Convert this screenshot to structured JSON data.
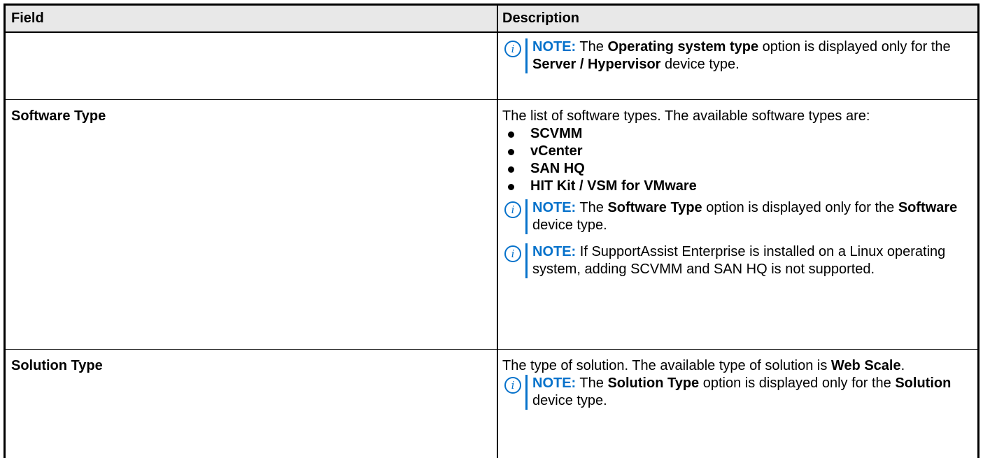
{
  "header": {
    "field": "Field",
    "description": "Description"
  },
  "row1": {
    "note_label": "NOTE:",
    "note_t1": " The ",
    "note_b1": "Operating system type",
    "note_t2": " option is displayed only for the ",
    "note_b2": "Server / Hypervisor",
    "note_t3": " device type."
  },
  "row2": {
    "field": "Software Type",
    "intro": "The list of software types. The available software types are:",
    "bullets": [
      "SCVMM",
      "vCenter",
      "SAN HQ",
      "HIT Kit / VSM for VMware"
    ],
    "note1_label": "NOTE:",
    "note1_t1": " The ",
    "note1_b1": "Software Type",
    "note1_t2": " option is displayed only for the ",
    "note1_b2": "Software",
    "note1_t3": " device type.",
    "note2_label": "NOTE:",
    "note2_text": " If SupportAssist Enterprise is installed on a Linux operating system, adding SCVMM and SAN HQ is not supported."
  },
  "row3": {
    "field": "Solution Type",
    "intro_t1": "The type of solution. The available type of solution is ",
    "intro_b1": "Web Scale",
    "intro_t2": ".",
    "note_label": "NOTE:",
    "note_t1": " The ",
    "note_b1": "Solution Type",
    "note_t2": " option is displayed only for the ",
    "note_b2": "Solution",
    "note_t3": " device type."
  }
}
